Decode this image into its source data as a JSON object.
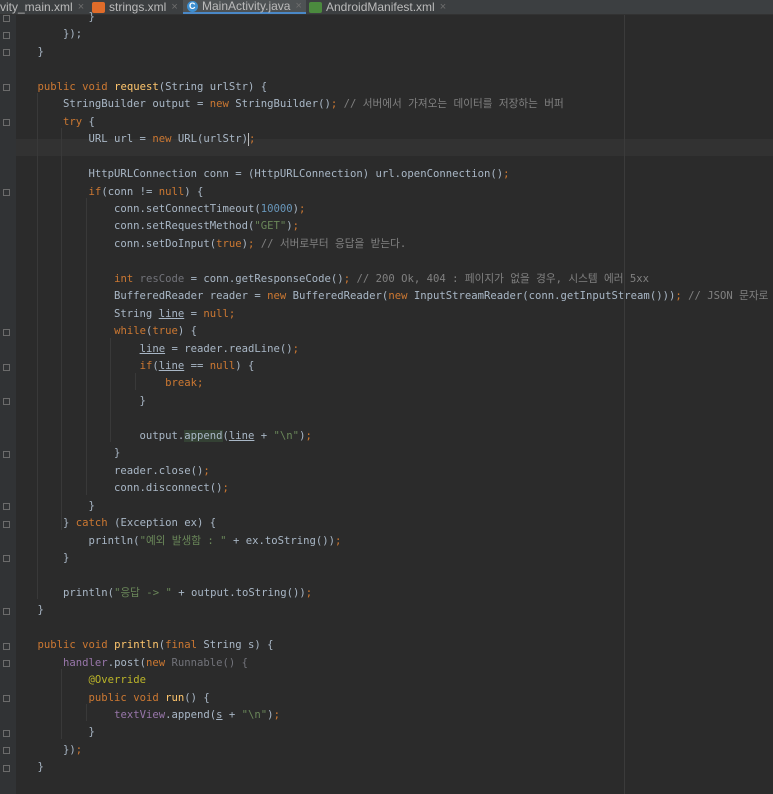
{
  "tabs": [
    {
      "label": "vity_main.xml",
      "icon": "xml-file-icon"
    },
    {
      "label": "strings.xml",
      "icon": "xml-file-icon"
    },
    {
      "label": "MainActivity.java",
      "icon": "java-class-icon",
      "active": true
    },
    {
      "label": "AndroidManifest.xml",
      "icon": "manifest-file-icon"
    }
  ],
  "close_glyph": "×",
  "code_lines": [
    [
      [
        "            }",
        ""
      ]
    ],
    [
      [
        "        });",
        ""
      ]
    ],
    [
      [
        "    }",
        ""
      ]
    ],
    [],
    [
      [
        "    ",
        ""
      ],
      [
        "public void ",
        "kw"
      ],
      [
        "request",
        "fn"
      ],
      [
        "(String urlStr) {",
        ""
      ]
    ],
    [
      [
        "        StringBuilder output = ",
        ""
      ],
      [
        "new ",
        "kw"
      ],
      [
        "StringBuilder()",
        ""
      ],
      [
        "; ",
        "kw"
      ],
      [
        "// 서버에서 가져오는 데이터를 저장하는 버퍼",
        "cm"
      ]
    ],
    [
      [
        "        ",
        ""
      ],
      [
        "try ",
        "kw"
      ],
      [
        "{",
        ""
      ]
    ],
    [
      [
        "            URL url = ",
        ""
      ],
      [
        "new ",
        "kw"
      ],
      [
        "URL(urlStr)",
        ""
      ],
      [
        ";",
        "kw"
      ]
    ],
    [],
    [
      [
        "            HttpURLConnection conn = (HttpURLConnection) url.openConnection()",
        ""
      ],
      [
        ";",
        "kw"
      ]
    ],
    [
      [
        "            ",
        ""
      ],
      [
        "if",
        "kw"
      ],
      [
        "(conn != ",
        ""
      ],
      [
        "null",
        "kw"
      ],
      [
        ") {",
        ""
      ]
    ],
    [
      [
        "                conn.setConnectTimeout(",
        ""
      ],
      [
        "10000",
        "num"
      ],
      [
        ")",
        ""
      ],
      [
        ";",
        "kw"
      ]
    ],
    [
      [
        "                conn.setRequestMethod(",
        ""
      ],
      [
        "\"GET\"",
        "str"
      ],
      [
        ")",
        ""
      ],
      [
        ";",
        "kw"
      ]
    ],
    [
      [
        "                conn.setDoInput(",
        ""
      ],
      [
        "true",
        "kw"
      ],
      [
        ")",
        ""
      ],
      [
        "; ",
        "kw"
      ],
      [
        "// 서버로부터 응답을 받는다.",
        "cm"
      ]
    ],
    [],
    [
      [
        "                ",
        ""
      ],
      [
        "int ",
        "kw"
      ],
      [
        "resCode",
        "unused"
      ],
      [
        " = conn.getResponseCode()",
        ""
      ],
      [
        "; ",
        "kw"
      ],
      [
        "// 200 Ok, 404 : 페이지가 없을 경우, 시스템 에러 5xx",
        "cm"
      ]
    ],
    [
      [
        "                BufferedReader reader = ",
        ""
      ],
      [
        "new ",
        "kw"
      ],
      [
        "BufferedReader(",
        ""
      ],
      [
        "new ",
        "kw"
      ],
      [
        "InputStreamReader(conn.getInputStream()))",
        ""
      ],
      [
        "; ",
        "kw"
      ],
      [
        "// JSON 문자로",
        "cm"
      ]
    ],
    [
      [
        "                String ",
        ""
      ],
      [
        "line",
        "ul"
      ],
      [
        " = ",
        ""
      ],
      [
        "null",
        "kw"
      ],
      [
        ";",
        "kw"
      ]
    ],
    [
      [
        "                ",
        ""
      ],
      [
        "while",
        "kw"
      ],
      [
        "(",
        ""
      ],
      [
        "true",
        "kw"
      ],
      [
        ") {",
        ""
      ]
    ],
    [
      [
        "                    ",
        ""
      ],
      [
        "line",
        "ul"
      ],
      [
        " = reader.readLine()",
        ""
      ],
      [
        ";",
        "kw"
      ]
    ],
    [
      [
        "                    ",
        ""
      ],
      [
        "if",
        "kw"
      ],
      [
        "(",
        ""
      ],
      [
        "line",
        "ul"
      ],
      [
        " == ",
        ""
      ],
      [
        "null",
        "kw"
      ],
      [
        ") {",
        ""
      ]
    ],
    [
      [
        "                        ",
        ""
      ],
      [
        "break",
        "kw"
      ],
      [
        ";",
        "kw"
      ]
    ],
    [
      [
        "                    }",
        ""
      ]
    ],
    [],
    [
      [
        "                    output.",
        ""
      ],
      [
        "append",
        "hl"
      ],
      [
        "(",
        ""
      ],
      [
        "line",
        "ul"
      ],
      [
        " + ",
        ""
      ],
      [
        "\"\\n\"",
        "str"
      ],
      [
        ")",
        ""
      ],
      [
        ";",
        "kw"
      ]
    ],
    [
      [
        "                }",
        ""
      ]
    ],
    [
      [
        "                reader.close()",
        ""
      ],
      [
        ";",
        "kw"
      ]
    ],
    [
      [
        "                conn.disconnect()",
        ""
      ],
      [
        ";",
        "kw"
      ]
    ],
    [
      [
        "            }",
        ""
      ]
    ],
    [
      [
        "        } ",
        ""
      ],
      [
        "catch ",
        "kw"
      ],
      [
        "(Exception ex) {",
        ""
      ]
    ],
    [
      [
        "            println(",
        ""
      ],
      [
        "\"예외 발생함 : \" ",
        "str"
      ],
      [
        "+ ex.toString())",
        ""
      ],
      [
        ";",
        "kw"
      ]
    ],
    [
      [
        "        }",
        ""
      ]
    ],
    [],
    [
      [
        "        println(",
        ""
      ],
      [
        "\"응답 -> \" ",
        "str"
      ],
      [
        "+ output.toString())",
        ""
      ],
      [
        ";",
        "kw"
      ]
    ],
    [
      [
        "    }",
        ""
      ]
    ],
    [],
    [
      [
        "    ",
        ""
      ],
      [
        "public void ",
        "kw"
      ],
      [
        "println",
        "fn"
      ],
      [
        "(",
        ""
      ],
      [
        "final ",
        "kw"
      ],
      [
        "String s) {",
        ""
      ]
    ],
    [
      [
        "        ",
        ""
      ],
      [
        "handler",
        "fld"
      ],
      [
        ".post(",
        ""
      ],
      [
        "new ",
        "kw"
      ],
      [
        "Runnable() {",
        "unused"
      ]
    ],
    [
      [
        "            ",
        ""
      ],
      [
        "@Override",
        "ann"
      ]
    ],
    [
      [
        "            ",
        ""
      ],
      [
        "public void ",
        "kw"
      ],
      [
        "run",
        "fn"
      ],
      [
        "() {",
        ""
      ]
    ],
    [
      [
        "                ",
        ""
      ],
      [
        "textView",
        "fld"
      ],
      [
        ".append(",
        ""
      ],
      [
        "s",
        "ul"
      ],
      [
        " + ",
        ""
      ],
      [
        "\"\\n\"",
        "str"
      ],
      [
        ")",
        ""
      ],
      [
        ";",
        "kw"
      ]
    ],
    [
      [
        "            }",
        ""
      ]
    ],
    [
      [
        "        })",
        ""
      ],
      [
        ";",
        "kw"
      ]
    ],
    [
      [
        "    }",
        ""
      ]
    ]
  ]
}
